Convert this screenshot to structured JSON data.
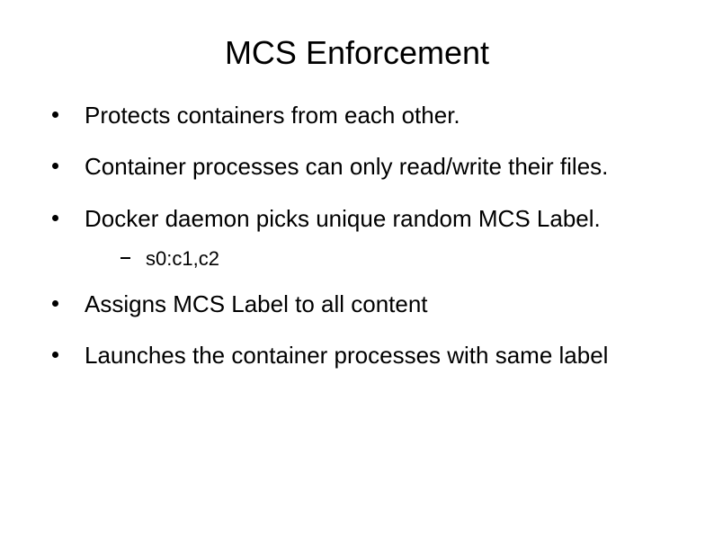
{
  "title": "MCS Enforcement",
  "bullets": {
    "b0": "Protects containers from each other.",
    "b1": "Container processes can only read/write their files.",
    "b2": "Docker daemon picks unique random MCS Label.",
    "b2_sub0": "s0:c1,c2",
    "b3": "Assigns MCS Label to all content",
    "b4": "Launches the container processes with same label"
  }
}
